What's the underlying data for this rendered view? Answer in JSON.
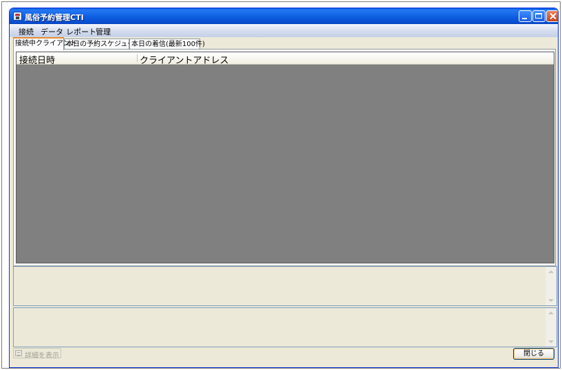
{
  "window": {
    "title": "風俗予約管理CTI"
  },
  "menu": [
    "接続",
    "データ",
    "レポート",
    "管理"
  ],
  "tabs": [
    {
      "label": "接続中クライアント",
      "active": true
    },
    {
      "label": "本日の予約スケジュール",
      "active": false
    },
    {
      "label": "本日の着信(最新100件)",
      "active": false
    }
  ],
  "list": {
    "columns": [
      "接続日時",
      "クライアントアドレス"
    ],
    "rows": []
  },
  "buttons": {
    "details": "詳細を表示",
    "close": "閉じる"
  },
  "colors": {
    "titlebar": "#0a5fe6",
    "list_bg": "#808080",
    "window_bg": "#ece9d8",
    "active_tab_accent": "#e68b2c"
  },
  "icons": [
    "app-phone-icon",
    "minimize-icon",
    "maximize-icon",
    "close-icon",
    "details-icon"
  ]
}
